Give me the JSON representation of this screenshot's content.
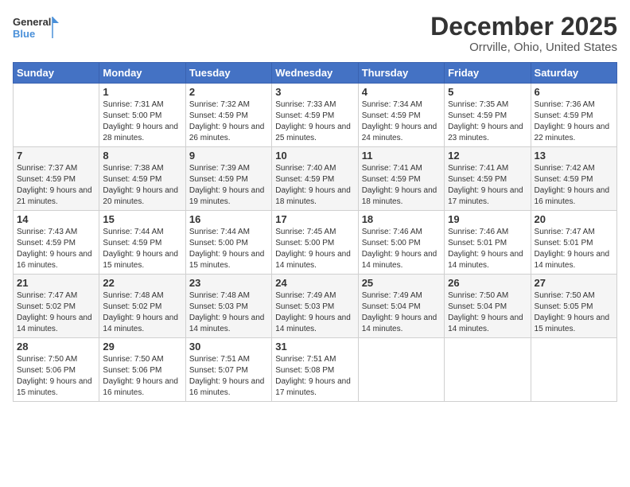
{
  "logo": {
    "line1": "General",
    "line2": "Blue"
  },
  "header": {
    "month": "December 2025",
    "location": "Orrville, Ohio, United States"
  },
  "weekdays": [
    "Sunday",
    "Monday",
    "Tuesday",
    "Wednesday",
    "Thursday",
    "Friday",
    "Saturday"
  ],
  "weeks": [
    [
      {
        "day": "",
        "empty": true
      },
      {
        "day": "1",
        "sunrise": "7:31 AM",
        "sunset": "5:00 PM",
        "daylight": "9 hours and 28 minutes."
      },
      {
        "day": "2",
        "sunrise": "7:32 AM",
        "sunset": "4:59 PM",
        "daylight": "9 hours and 26 minutes."
      },
      {
        "day": "3",
        "sunrise": "7:33 AM",
        "sunset": "4:59 PM",
        "daylight": "9 hours and 25 minutes."
      },
      {
        "day": "4",
        "sunrise": "7:34 AM",
        "sunset": "4:59 PM",
        "daylight": "9 hours and 24 minutes."
      },
      {
        "day": "5",
        "sunrise": "7:35 AM",
        "sunset": "4:59 PM",
        "daylight": "9 hours and 23 minutes."
      },
      {
        "day": "6",
        "sunrise": "7:36 AM",
        "sunset": "4:59 PM",
        "daylight": "9 hours and 22 minutes."
      }
    ],
    [
      {
        "day": "7",
        "sunrise": "7:37 AM",
        "sunset": "4:59 PM",
        "daylight": "9 hours and 21 minutes."
      },
      {
        "day": "8",
        "sunrise": "7:38 AM",
        "sunset": "4:59 PM",
        "daylight": "9 hours and 20 minutes."
      },
      {
        "day": "9",
        "sunrise": "7:39 AM",
        "sunset": "4:59 PM",
        "daylight": "9 hours and 19 minutes."
      },
      {
        "day": "10",
        "sunrise": "7:40 AM",
        "sunset": "4:59 PM",
        "daylight": "9 hours and 18 minutes."
      },
      {
        "day": "11",
        "sunrise": "7:41 AM",
        "sunset": "4:59 PM",
        "daylight": "9 hours and 18 minutes."
      },
      {
        "day": "12",
        "sunrise": "7:41 AM",
        "sunset": "4:59 PM",
        "daylight": "9 hours and 17 minutes."
      },
      {
        "day": "13",
        "sunrise": "7:42 AM",
        "sunset": "4:59 PM",
        "daylight": "9 hours and 16 minutes."
      }
    ],
    [
      {
        "day": "14",
        "sunrise": "7:43 AM",
        "sunset": "4:59 PM",
        "daylight": "9 hours and 16 minutes."
      },
      {
        "day": "15",
        "sunrise": "7:44 AM",
        "sunset": "4:59 PM",
        "daylight": "9 hours and 15 minutes."
      },
      {
        "day": "16",
        "sunrise": "7:44 AM",
        "sunset": "5:00 PM",
        "daylight": "9 hours and 15 minutes."
      },
      {
        "day": "17",
        "sunrise": "7:45 AM",
        "sunset": "5:00 PM",
        "daylight": "9 hours and 14 minutes."
      },
      {
        "day": "18",
        "sunrise": "7:46 AM",
        "sunset": "5:00 PM",
        "daylight": "9 hours and 14 minutes."
      },
      {
        "day": "19",
        "sunrise": "7:46 AM",
        "sunset": "5:01 PM",
        "daylight": "9 hours and 14 minutes."
      },
      {
        "day": "20",
        "sunrise": "7:47 AM",
        "sunset": "5:01 PM",
        "daylight": "9 hours and 14 minutes."
      }
    ],
    [
      {
        "day": "21",
        "sunrise": "7:47 AM",
        "sunset": "5:02 PM",
        "daylight": "9 hours and 14 minutes."
      },
      {
        "day": "22",
        "sunrise": "7:48 AM",
        "sunset": "5:02 PM",
        "daylight": "9 hours and 14 minutes."
      },
      {
        "day": "23",
        "sunrise": "7:48 AM",
        "sunset": "5:03 PM",
        "daylight": "9 hours and 14 minutes."
      },
      {
        "day": "24",
        "sunrise": "7:49 AM",
        "sunset": "5:03 PM",
        "daylight": "9 hours and 14 minutes."
      },
      {
        "day": "25",
        "sunrise": "7:49 AM",
        "sunset": "5:04 PM",
        "daylight": "9 hours and 14 minutes."
      },
      {
        "day": "26",
        "sunrise": "7:50 AM",
        "sunset": "5:04 PM",
        "daylight": "9 hours and 14 minutes."
      },
      {
        "day": "27",
        "sunrise": "7:50 AM",
        "sunset": "5:05 PM",
        "daylight": "9 hours and 15 minutes."
      }
    ],
    [
      {
        "day": "28",
        "sunrise": "7:50 AM",
        "sunset": "5:06 PM",
        "daylight": "9 hours and 15 minutes."
      },
      {
        "day": "29",
        "sunrise": "7:50 AM",
        "sunset": "5:06 PM",
        "daylight": "9 hours and 16 minutes."
      },
      {
        "day": "30",
        "sunrise": "7:51 AM",
        "sunset": "5:07 PM",
        "daylight": "9 hours and 16 minutes."
      },
      {
        "day": "31",
        "sunrise": "7:51 AM",
        "sunset": "5:08 PM",
        "daylight": "9 hours and 17 minutes."
      },
      {
        "day": "",
        "empty": true
      },
      {
        "day": "",
        "empty": true
      },
      {
        "day": "",
        "empty": true
      }
    ]
  ]
}
